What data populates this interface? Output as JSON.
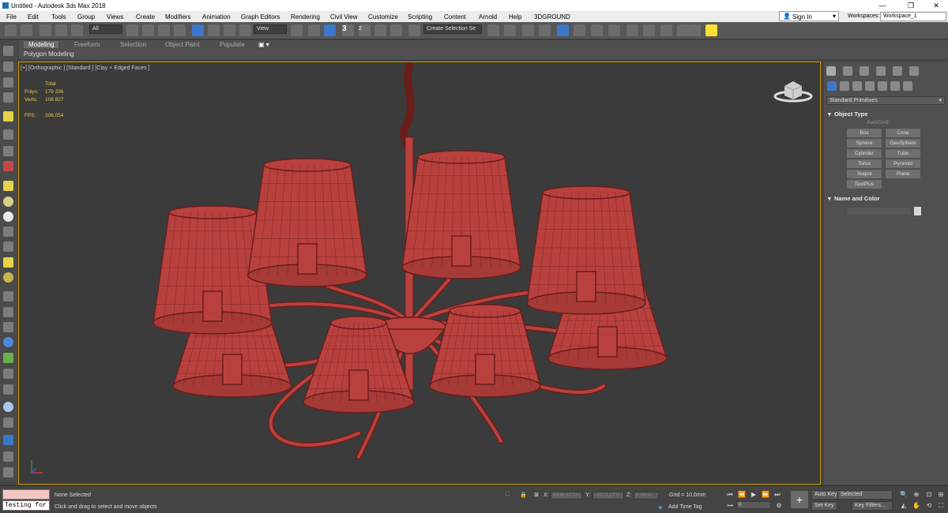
{
  "window": {
    "title": "Untitled - Autodesk 3ds Max 2018",
    "minimize": "—",
    "maximize": "❐",
    "close": "✕"
  },
  "menu": [
    "File",
    "Edit",
    "Tools",
    "Group",
    "Views",
    "Create",
    "Modifiers",
    "Animation",
    "Graph Editors",
    "Rendering",
    "Civil View",
    "Customize",
    "Scripting",
    "Content",
    "Arnold",
    "Help",
    "3DGROUND"
  ],
  "signin": "Sign In",
  "workspace": {
    "label": "Workspaces:",
    "value": "Workspace_1"
  },
  "toolbar": {
    "filter": "All",
    "refcoord": "View",
    "selection_set": "Create Selection Se",
    "snap_num": "3",
    "snap_angle": "2"
  },
  "ribbon": {
    "tabs": [
      "Modeling",
      "Freeform",
      "Selection",
      "Object Paint",
      "Populate"
    ],
    "active": "Modeling",
    "subbar": "Polygon Modeling"
  },
  "viewport": {
    "label": "[+] [Orthographic ] [Standard ] [Clay + Edged Faces ]",
    "stats": {
      "total": "Total",
      "polys_label": "Polys:",
      "polys": "179 336",
      "verts_label": "Verts:",
      "verts": "108 827",
      "fps_label": "FPS:",
      "fps": "306,054"
    },
    "mesh_color": "#b8413e",
    "border_color": "#c89a00"
  },
  "command_panel": {
    "category": "Standard Primitives",
    "object_type_title": "Object Type",
    "autogrid": "AutoGrid",
    "buttons": [
      "Box",
      "Cone",
      "Sphere",
      "GeoSphere",
      "Cylinder",
      "Tube",
      "Torus",
      "Pyramid",
      "Teapot",
      "Plane",
      "TextPlus"
    ],
    "name_color_title": "Name and Color"
  },
  "status": {
    "script_input": "Testing for",
    "selection": "None Selected",
    "prompt": "Click and drag to select and move objects",
    "x_label": "X:",
    "x": "6538,677m",
    "y_label": "Y:",
    "y": "-5572,277r",
    "z_label": "Z:",
    "z": "0,0mm",
    "grid": "Grid = 10,0mm",
    "add_time_tag": "Add Time Tag",
    "auto_key": "Auto Key",
    "key_mode": "Selected",
    "set_key": "Set Key",
    "key_filters": "Key Filters...",
    "frame": "0"
  }
}
